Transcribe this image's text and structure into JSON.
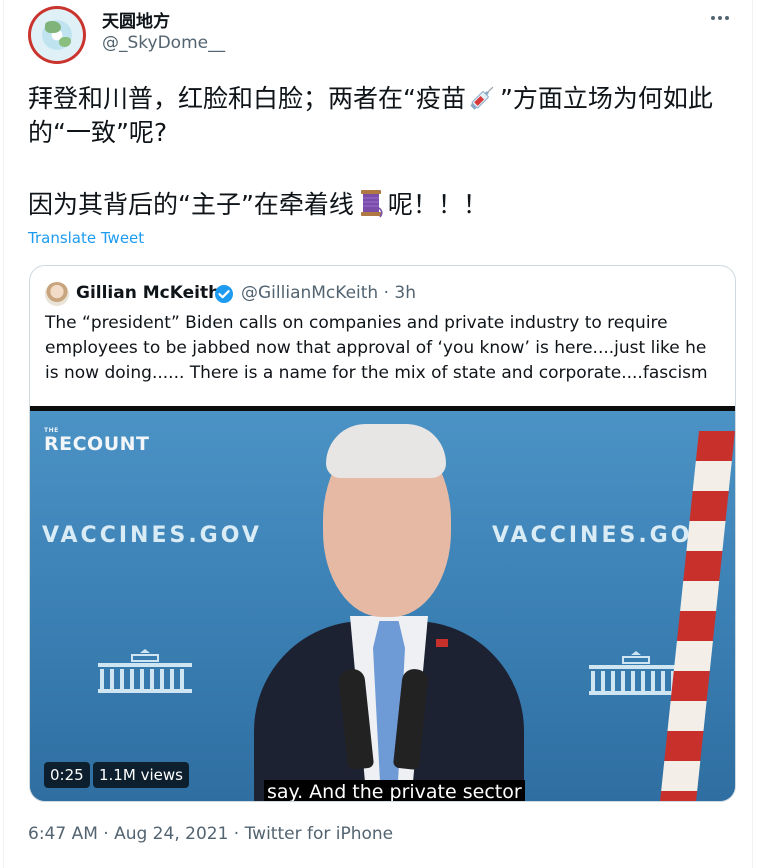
{
  "tweet": {
    "display_name": "天圆地方",
    "handle": "@_SkyDome__",
    "text_part1": "拜登和川普，红脸和白脸；两者在“疫苗",
    "text_part2": "”方面立场为何如此的“一致”呢?",
    "text2_part1": "因为其背后的“主子”在牵着线",
    "text2_part2": "呢！！！",
    "emoji_syringe": "syringe-emoji",
    "emoji_thread": "thread-spool-emoji",
    "translate_label": "Translate Tweet",
    "timestamp": "6:47 AM · Aug 24, 2021 · Twitter for iPhone"
  },
  "quoted": {
    "display_name": "Gillian McKeith",
    "handle_time": "@GillianMcKeith · 3h",
    "text": "The “president” Biden calls on companies and private industry to require employees to be jabbed now that approval of ‘you know’ is here....just like he is now doing...... There is a name for the mix of state and corporate....fascism",
    "video": {
      "brand_small": "THE",
      "brand": "RECOUNT",
      "backdrop_left": "VACCINES.GOV",
      "backdrop_right": "VACCINES.GOV",
      "duration": "0:25",
      "views": "1.1M views",
      "caption": "say. And the private sector"
    }
  },
  "colors": {
    "accent": "#1d9bf0",
    "secondary_text": "#536471",
    "border": "#cfd9de"
  }
}
